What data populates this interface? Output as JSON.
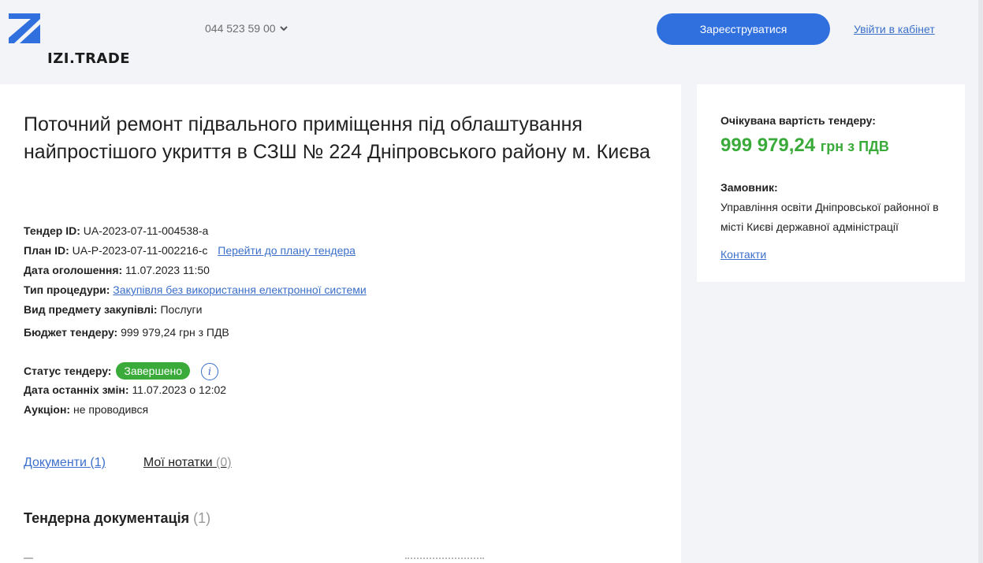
{
  "header": {
    "logo_text": "IZI.TRADE",
    "phone": "044 523 59 00",
    "register_label": "Зареєструватися",
    "login_label": "Увійти в кабінет"
  },
  "tender": {
    "title": "Поточний ремонт підвального приміщення під облаштування найпростішого укриття в СЗШ № 224 Дніпровського району м. Києва",
    "fields": {
      "id_label": "Тендер ID:",
      "id_value": "UA-2023-07-11-004538-a",
      "plan_label": "План ID:",
      "plan_value": "UA-P-2023-07-11-002216-c",
      "plan_link": "Перейти до плану тендера",
      "date_label": "Дата оголошення:",
      "date_value": "11.07.2023 11:50",
      "procedure_label": "Тип процедури:",
      "procedure_value": "Закупівля без використання електронної системи",
      "subject_label": "Вид предмету закупівлі:",
      "subject_value": "Послуги",
      "budget_label": "Бюджет тендеру:",
      "budget_value": "999 979,24 грн з ПДВ",
      "status_label": "Статус тендеру:",
      "status_value": "Завершено",
      "changed_label": "Дата останніх змін:",
      "changed_value": "11.07.2023 о 12:02",
      "auction_label": "Аукціон:",
      "auction_value": "не проводився"
    },
    "tabs": {
      "docs_label": "Документи (1)",
      "notes_label": "Мої нотатки",
      "notes_count": "(0)"
    },
    "docs_section": {
      "title": "Тендерна документація",
      "count": "(1)"
    }
  },
  "sidebar": {
    "expected_value_label": "Очікувана вартість тендеру:",
    "price_amount": "999 979,24",
    "price_unit": "грн з ПДВ",
    "customer_label": "Замовник:",
    "customer_name": "Управління освіти Дніпровської районної в місті Києві державної адміністрації",
    "contacts_label": "Контакти"
  },
  "colors": {
    "accent": "#2f6fde",
    "link": "#3b6fc9",
    "success": "#3aab3a",
    "background": "#f2f4f8"
  },
  "icons": {
    "logo": "izi-trade-logo-icon",
    "phone_dropdown": "chevron-down-icon",
    "status_info": "info-icon"
  }
}
